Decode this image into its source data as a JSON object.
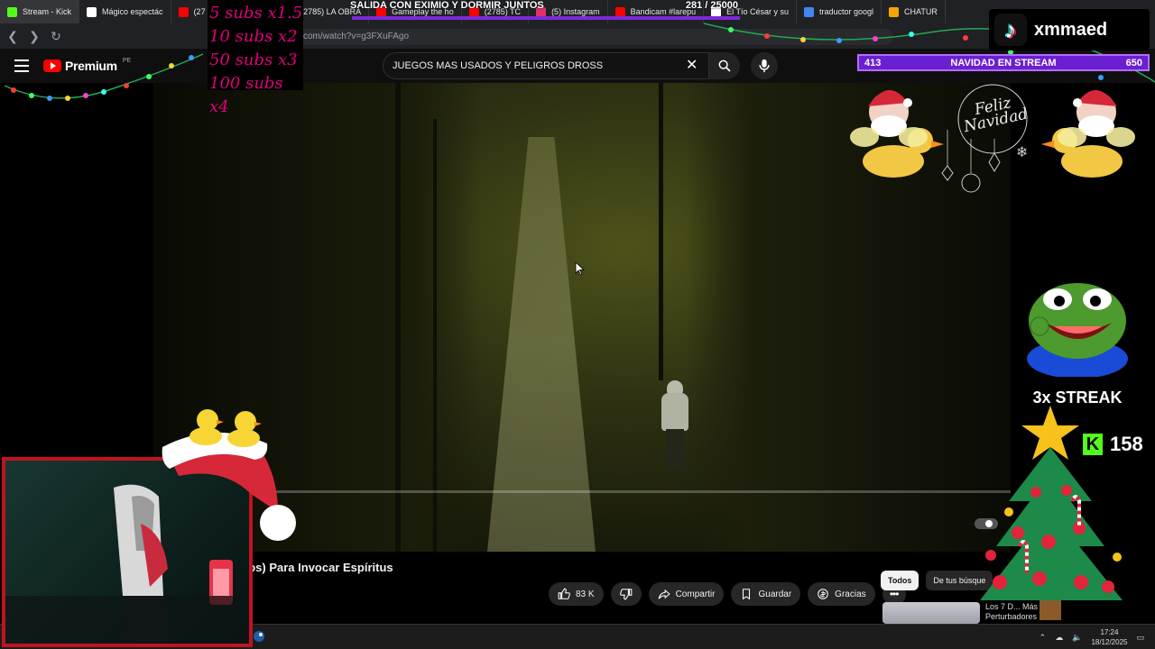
{
  "browser": {
    "tabs": [
      {
        "label": "Stream - Kick",
        "color": "#53fc18"
      },
      {
        "label": "Mágico espectác",
        "color": "#ffffff"
      },
      {
        "label": "(27",
        "color": "#ff0000"
      },
      {
        "label": "t ChatBot",
        "color": "#9aa0a6"
      },
      {
        "label": "(2785) LA OBRA",
        "color": "#ff0000"
      },
      {
        "label": "Gameplay the ho",
        "color": "#ff0000"
      },
      {
        "label": "(2785) TC",
        "color": "#ff0000"
      },
      {
        "label": "(5) Instagram",
        "color": "#e1306c"
      },
      {
        "label": "Bandicam #larepu",
        "color": "#ff0000"
      },
      {
        "label": "El Tío César y su",
        "color": "#ffffff"
      },
      {
        "label": "traductor googl",
        "color": "#4285f4"
      },
      {
        "label": "CHATUR",
        "color": "#f4a700"
      }
    ],
    "url": "com/watch?v=g3FXuFAgo"
  },
  "youtube": {
    "brand": "Premium",
    "region": "PE",
    "search_query": "JUEGOS MAS USADOS Y PELIGROS DROSS",
    "video_progress": 0.0,
    "video_title": "sos) Para Invocar Espíritus",
    "likes": "83 K",
    "share_label": "Compartir",
    "save_label": "Guardar",
    "thanks_label": "Gracias",
    "chips": [
      "Todos",
      "De tus búsque"
    ],
    "rec_text": "Los 7 D... Más Perturbadores"
  },
  "overlay": {
    "subs_multipliers": [
      "5 subs x1.5",
      "10 subs x2",
      "50 subs x3",
      "100 subs x4"
    ],
    "banner_title": "SALIDA CON EXIMIO Y DORMIR JUNTOS",
    "banner_goal": "281 / 25000",
    "tiktok_user": "xmmaed",
    "event_label": "NAVIDAD EN STREAM",
    "event_left": "413",
    "event_right": "650",
    "streak_label": "3x STREAK",
    "kick_viewers": "158",
    "greeting": "Feliz Navidad"
  },
  "taskbar": {
    "time": "17:24",
    "date": "18/12/2025"
  },
  "colors": {
    "youtube_red": "#ff0000",
    "kick_green": "#53fc18",
    "stream_purple": "#6a1fd0",
    "subs_pink": "#e0007a",
    "webcam_border": "#c1121f"
  }
}
